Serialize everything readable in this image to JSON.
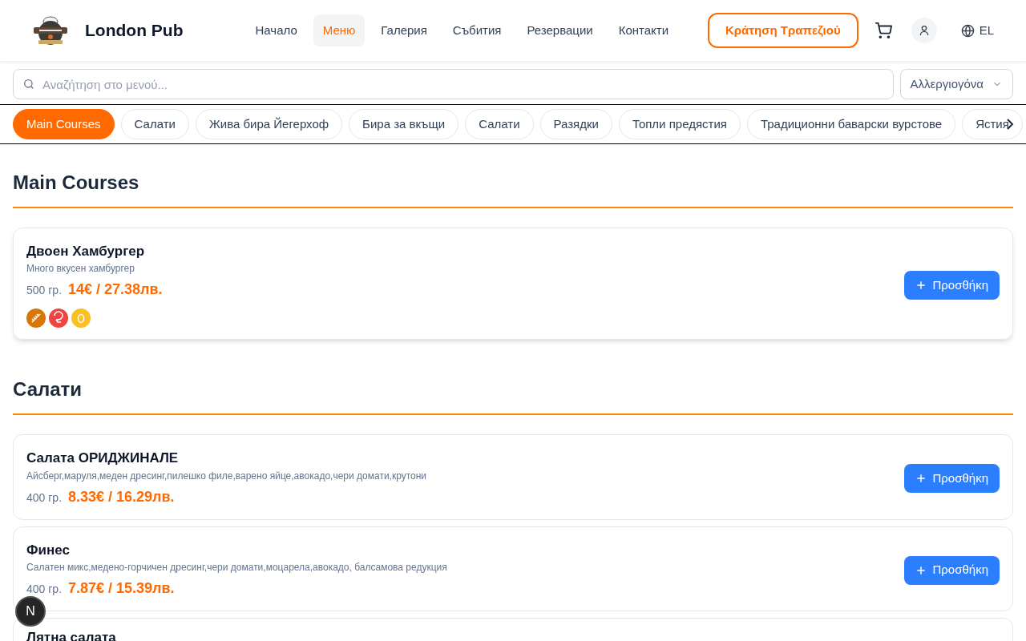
{
  "brand": {
    "name": "London Pub"
  },
  "nav": [
    {
      "label": "Начало",
      "selected": false
    },
    {
      "label": "Меню",
      "selected": true
    },
    {
      "label": "Галерия",
      "selected": false
    },
    {
      "label": "Събития",
      "selected": false
    },
    {
      "label": "Резервации",
      "selected": false
    },
    {
      "label": "Контакти",
      "selected": false
    }
  ],
  "reserve_button": "Κράτηση Τραπεζιού",
  "language": "EL",
  "search": {
    "placeholder": "Αναζήτηση στο μενού..."
  },
  "allergen_filter": "Αλλεργιογόνα",
  "categories": [
    {
      "label": "Main Courses",
      "selected": true
    },
    {
      "label": "Салати",
      "selected": false
    },
    {
      "label": "Жива бира Йегерхоф",
      "selected": false
    },
    {
      "label": "Бира за вкъщи",
      "selected": false
    },
    {
      "label": "Салати",
      "selected": false
    },
    {
      "label": "Разядки",
      "selected": false
    },
    {
      "label": "Топли предястия",
      "selected": false
    },
    {
      "label": "Традиционни баварски вурстове",
      "selected": false
    },
    {
      "label": "Ястия",
      "selected": false
    }
  ],
  "sections": [
    {
      "title": "Main Courses",
      "items": [
        {
          "name": "Двоен Хамбургер",
          "description": "Много вкусен хамбургер",
          "weight": "500 гр.",
          "price": "14€ / 27.38лв.",
          "button": "Προσθήκη",
          "allergens": [
            {
              "kind": "gluten",
              "color": "#d97706"
            },
            {
              "kind": "shellfish",
              "color": "#ef4444"
            },
            {
              "kind": "egg",
              "color": "#fbbf24"
            }
          ]
        }
      ]
    },
    {
      "title": "Салати",
      "items": [
        {
          "name": "Салата ОРИДЖИНАЛЕ",
          "description": "Айсберг,маруля,меден дресинг,пилешко филе,варено яйце,авокадо,чери домати,крутони",
          "weight": "400 гр.",
          "price": "8.33€ / 16.29лв.",
          "button": "Προσθήκη"
        },
        {
          "name": "Финес",
          "description": "Салатен микс,медено-горчичен дресинг,чери домати,моцарела,авокадо, балсамова редукция",
          "weight": "400 гр.",
          "price": "7.87€ / 15.39лв.",
          "button": "Προσθήκη"
        },
        {
          "name": "Лятна салата"
        }
      ]
    }
  ],
  "dev_badge": "N"
}
